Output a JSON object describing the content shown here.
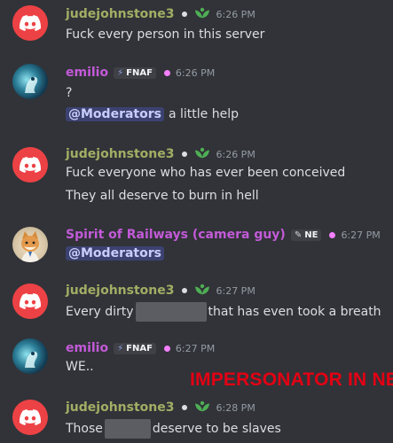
{
  "messages": [
    {
      "author": "judejohnstone3",
      "time": "6:26 PM",
      "lines": [
        "Fuck every person in this server"
      ]
    },
    {
      "author": "emilio",
      "tag": "FNAF",
      "time": "6:26 PM",
      "lines": [
        "?"
      ],
      "mention": "@Moderators",
      "mention_tail": "a little help"
    },
    {
      "author": "judejohnstone3",
      "time": "6:26 PM",
      "lines": [
        "Fuck everyone who has ever been conceived",
        "They all deserve to burn in hell"
      ]
    },
    {
      "author": "Spirit of Railways (camera guy)",
      "tag": "NE",
      "time": "6:27 PM",
      "mention": "@Moderators"
    },
    {
      "author": "judejohnstone3",
      "time": "6:27 PM",
      "line_pre": "Every dirty",
      "line_post": "that has even took a breath"
    },
    {
      "author": "emilio",
      "tag": "FNAF",
      "time": "6:27 PM",
      "lines": [
        "WE.."
      ]
    },
    {
      "author": "judejohnstone3",
      "time": "6:28 PM",
      "line_pre": "Those",
      "line_post": "deserve to be slaves"
    }
  ],
  "overlay": "IMPERSONATOR IN NE",
  "colors": {
    "background": "#313338",
    "judy_name": "#a3ad64",
    "purple_name": "#c35ad8",
    "discord_red": "#ed4245",
    "overlay_red": "#e30014"
  }
}
